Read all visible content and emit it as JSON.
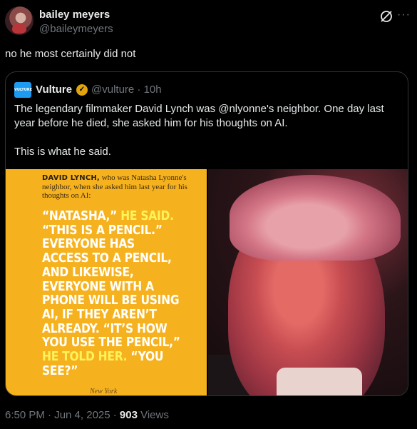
{
  "author": {
    "name": "bailey meyers",
    "handle": "@baileymeyers"
  },
  "tweet_text": "no he most certainly did not",
  "quoted": {
    "logo_text": "VULTURE",
    "name": "Vulture",
    "handle_time": "@vulture · 10h",
    "paragraph1": "The legendary filmmaker David Lynch was @nlyonne's neighbor. One day last year before he died, she asked him for his thoughts on AI.",
    "paragraph2": "This is what he said.",
    "image_text": {
      "intro_bold": "DAVID LYNCH,",
      "intro_rest": " who was Natasha Lyonne's neighbor, when she asked him last year for his thoughts on AI:",
      "quote_parts": [
        {
          "text": "“NATASHA,” ",
          "highlight": false
        },
        {
          "text": "HE SAID.",
          "highlight": true
        },
        {
          "text": " “THIS IS A PENCIL.” EVERYONE HAS ACCESS TO A PENCIL, AND LIKEWISE, EVERYONE WITH A PHONE WILL BE USING AI, IF THEY AREN’T ALREADY. “IT’S HOW YOU USE THE PENCIL,” ",
          "highlight": false
        },
        {
          "text": "HE TOLD HER.",
          "highlight": true
        },
        {
          "text": " “YOU SEE?”",
          "highlight": false
        }
      ],
      "signature": "New York"
    }
  },
  "meta": {
    "time": "6:50 PM · Jun 4, 2025 · ",
    "views_count": "903",
    "views_label": " Views"
  },
  "colors": {
    "panel_yellow": "#f6b21e",
    "highlight_yellow": "#fff35a",
    "muted": "#71767b"
  }
}
